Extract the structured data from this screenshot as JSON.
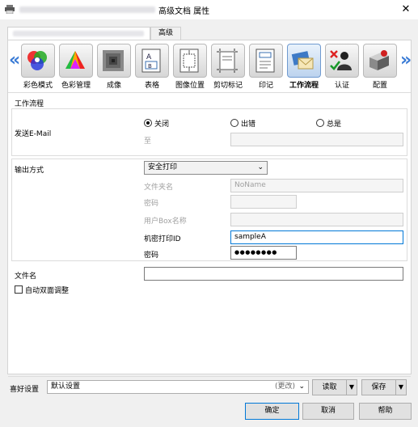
{
  "window": {
    "title": "高级文档 属性",
    "close_glyph": "✕"
  },
  "tabs": [
    {
      "label": ""
    },
    {
      "label": "高级"
    }
  ],
  "toolbar": {
    "prev_glyph": "«",
    "next_glyph": "»",
    "items": [
      {
        "label": "彩色模式",
        "icon": "color-mode-icon"
      },
      {
        "label": "色彩管理",
        "icon": "color-management-icon"
      },
      {
        "label": "成像",
        "icon": "imaging-icon"
      },
      {
        "label": "表格",
        "icon": "form-icon"
      },
      {
        "label": "图像位置",
        "icon": "image-position-icon"
      },
      {
        "label": "剪切标记",
        "icon": "crop-marks-icon"
      },
      {
        "label": "印记",
        "icon": "stamp-icon"
      },
      {
        "label": "工作流程",
        "icon": "workflow-icon",
        "selected": true
      },
      {
        "label": "认证",
        "icon": "authentication-icon"
      },
      {
        "label": "配置",
        "icon": "configuration-icon"
      }
    ]
  },
  "workflow": {
    "section_title": "工作流程",
    "email": {
      "label": "发送E-Mail",
      "options": [
        "关闭",
        "出错",
        "总是"
      ],
      "selected": "关闭",
      "to_label": "至",
      "to_value": ""
    },
    "output": {
      "label": "输出方式",
      "selected": "安全打印",
      "folder_label": "文件夹名",
      "folder_value": "NoName",
      "password1_label": "密码",
      "password1_value": "",
      "box_label": "用户Box名称",
      "box_value": "",
      "secure_id_label": "机密打印ID",
      "secure_id_value": "sampleA",
      "password2_label": "密码",
      "password2_value": "●●●●●●●●"
    },
    "filename_label": "文件名",
    "filename_value": "",
    "auto_duplex_label": "自动双面调整"
  },
  "favorites": {
    "label": "喜好设置",
    "value": "默认设置",
    "changed": "(更改)",
    "load_label": "读取",
    "save_label": "保存"
  },
  "footer": {
    "ok": "确定",
    "cancel": "取消",
    "help": "帮助"
  },
  "colors": {
    "accent": "#0078d7",
    "nav_arrow": "#3a7bd5"
  }
}
